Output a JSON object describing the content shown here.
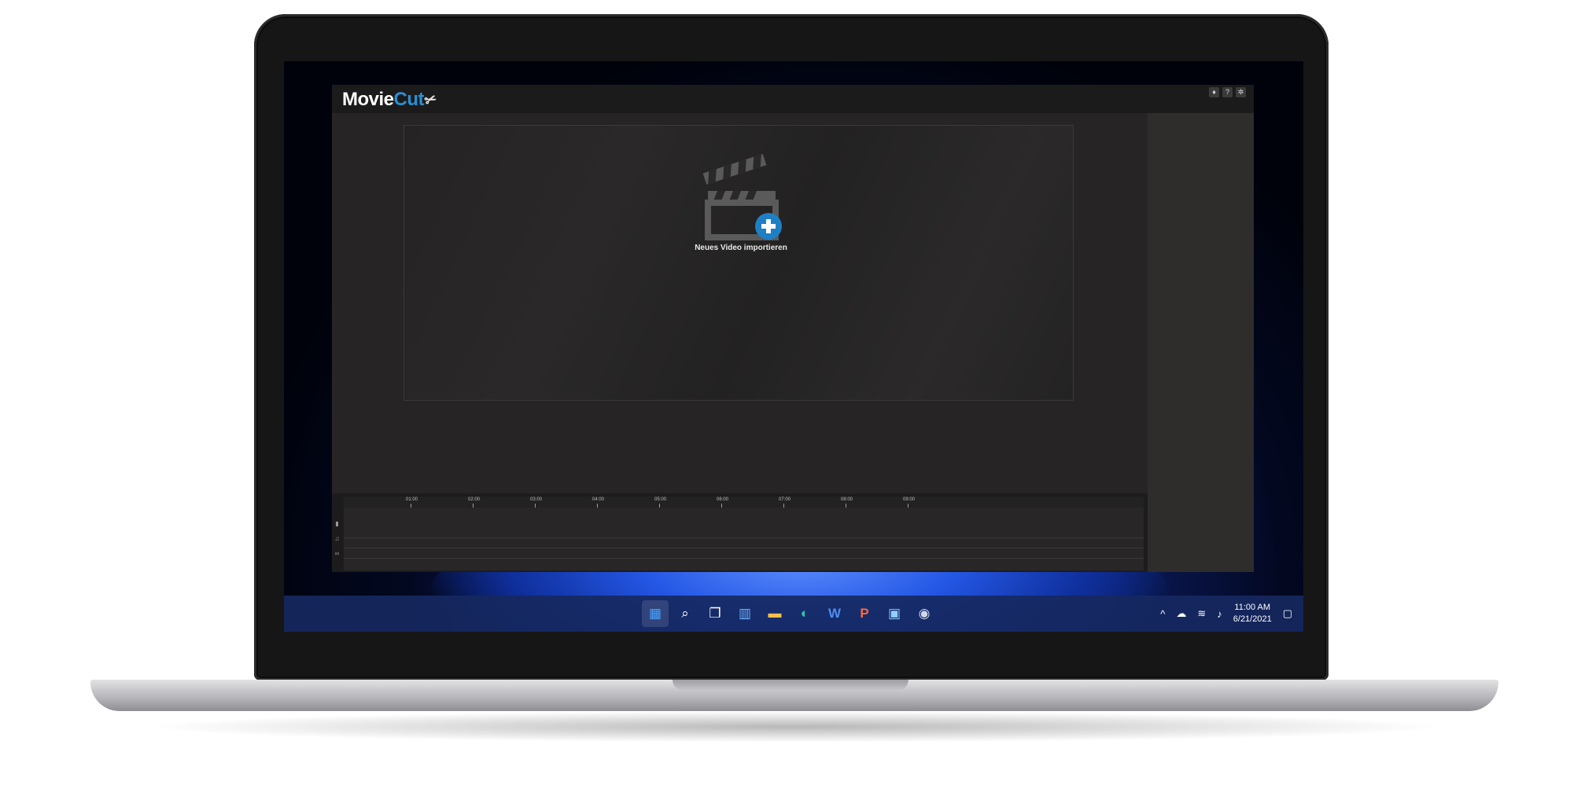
{
  "app": {
    "logo_main": "Movie",
    "logo_accent": "Cut",
    "window_buttons": [
      {
        "icon": "lightbulb-icon",
        "glyph": "♦"
      },
      {
        "icon": "help-icon",
        "glyph": "?"
      },
      {
        "icon": "gear-icon",
        "glyph": "✲"
      }
    ],
    "import_label": "Neues Video importieren",
    "accent_color": "#2a8fd4"
  },
  "timeline": {
    "ticks": [
      "01:00",
      "02:00",
      "03:00",
      "04:00",
      "05:00",
      "06:00",
      "07:00",
      "08:00",
      "09:00"
    ],
    "track_icons": [
      "video-track-icon",
      "audio-track-icon",
      "link-icon",
      "lock-icon"
    ]
  },
  "taskbar": {
    "apps": [
      {
        "name": "start-button",
        "glyph": "▦"
      },
      {
        "name": "search-button",
        "glyph": "⌕"
      },
      {
        "name": "task-view-button",
        "glyph": "❐"
      },
      {
        "name": "widgets-button",
        "glyph": "▥"
      },
      {
        "name": "file-explorer-button",
        "glyph": "▬"
      },
      {
        "name": "edge-button",
        "glyph": "◐"
      },
      {
        "name": "word-button",
        "glyph": "W"
      },
      {
        "name": "powerpoint-button",
        "glyph": "P"
      },
      {
        "name": "store-button",
        "glyph": "▣"
      },
      {
        "name": "steam-button",
        "glyph": "◉"
      }
    ],
    "tray": {
      "chevron": "^",
      "cloud": "☁",
      "wifi": "≋",
      "volume": "♪",
      "time": "11:00 AM",
      "date": "6/21/2021",
      "notification": "▢"
    }
  }
}
